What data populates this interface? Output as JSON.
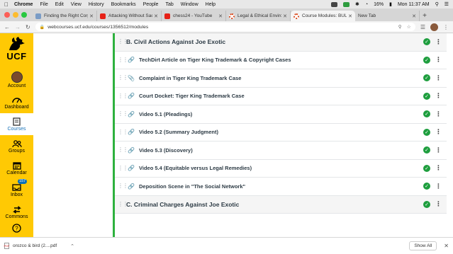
{
  "menubar": {
    "items": [
      "Chrome",
      "File",
      "Edit",
      "View",
      "History",
      "Bookmarks",
      "People",
      "Tab",
      "Window",
      "Help"
    ],
    "battery": "16%",
    "clock": "Mon 11:37 AM"
  },
  "tabs": [
    {
      "title": "Finding the Right Corp",
      "favicon_color": "#7a9cc6"
    },
    {
      "title": "Attacking Without Sac",
      "favicon_color": "#e62117"
    },
    {
      "title": "chess24 - YouTube",
      "favicon_color": "#e62117"
    },
    {
      "title": "Legal & Ethical Enviro",
      "favicon_color": "#d9481c"
    },
    {
      "title": "Course Modules: BUL3",
      "favicon_color": "#d9481c",
      "active": true
    },
    {
      "title": "New Tab",
      "favicon_color": "#f4f4f4"
    }
  ],
  "address": {
    "url": "webcourses.ucf.edu/courses/1356512/modules"
  },
  "global_nav": {
    "logo_text": "UCF",
    "items": [
      {
        "label": "Account",
        "icon": "account-avatar"
      },
      {
        "label": "Dashboard",
        "icon": "dashboard-icon"
      },
      {
        "label": "Courses",
        "icon": "courses-icon",
        "active": true
      },
      {
        "label": "Groups",
        "icon": "groups-icon"
      },
      {
        "label": "Calendar",
        "icon": "calendar-icon"
      },
      {
        "label": "Inbox",
        "icon": "inbox-icon",
        "badge": "157"
      },
      {
        "label": "Commons",
        "icon": "commons-icon"
      },
      {
        "label": "",
        "icon": "help-icon"
      }
    ]
  },
  "module": {
    "header": "B. Civil Actions Against Joe Exotic",
    "items": [
      {
        "title": "TechDirt Article on Tiger King Trademark & Copyright Cases",
        "icon": "link-icon"
      },
      {
        "title": "Complaint in Tiger King Trademark Case",
        "icon": "attachment-icon"
      },
      {
        "title": "Court Docket: Tiger King Trademark Case",
        "icon": "link-icon"
      },
      {
        "title": "Video 5.1 (Pleadings)",
        "icon": "link-icon"
      },
      {
        "title": "Video 5.2 (Summary Judgment)",
        "icon": "link-icon"
      },
      {
        "title": "Video 5.3 (Discovery)",
        "icon": "link-icon"
      },
      {
        "title": "Video 5.4 (Equitable versus Legal Remedies)",
        "icon": "link-icon"
      },
      {
        "title": "Deposition Scene in \"The Social Network\"",
        "icon": "link-icon"
      }
    ],
    "next_header": "C. Criminal Charges Against Joe Exotic",
    "accent": "#2eb13e",
    "check_color": "#1e9e3e"
  },
  "downloads": {
    "filename": "orozco & bird (2....pdf",
    "show_all": "Show All"
  }
}
